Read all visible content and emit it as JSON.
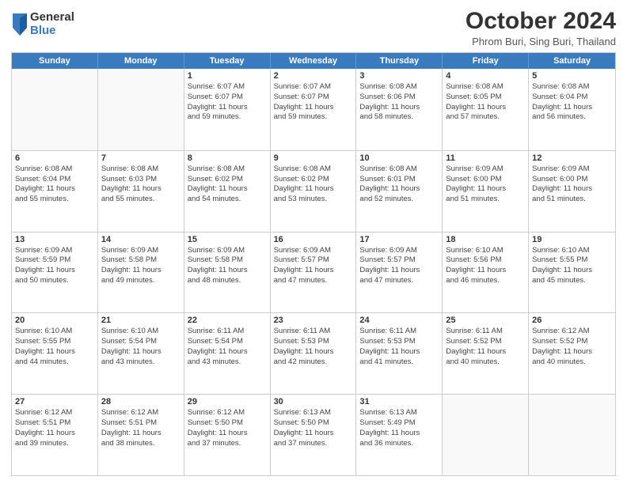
{
  "logo": {
    "general": "General",
    "blue": "Blue"
  },
  "header": {
    "title": "October 2024",
    "subtitle": "Phrom Buri, Sing Buri, Thailand"
  },
  "weekdays": [
    "Sunday",
    "Monday",
    "Tuesday",
    "Wednesday",
    "Thursday",
    "Friday",
    "Saturday"
  ],
  "weeks": [
    [
      {
        "day": "",
        "lines": []
      },
      {
        "day": "",
        "lines": []
      },
      {
        "day": "1",
        "lines": [
          "Sunrise: 6:07 AM",
          "Sunset: 6:07 PM",
          "Daylight: 11 hours",
          "and 59 minutes."
        ]
      },
      {
        "day": "2",
        "lines": [
          "Sunrise: 6:07 AM",
          "Sunset: 6:07 PM",
          "Daylight: 11 hours",
          "and 59 minutes."
        ]
      },
      {
        "day": "3",
        "lines": [
          "Sunrise: 6:08 AM",
          "Sunset: 6:06 PM",
          "Daylight: 11 hours",
          "and 58 minutes."
        ]
      },
      {
        "day": "4",
        "lines": [
          "Sunrise: 6:08 AM",
          "Sunset: 6:05 PM",
          "Daylight: 11 hours",
          "and 57 minutes."
        ]
      },
      {
        "day": "5",
        "lines": [
          "Sunrise: 6:08 AM",
          "Sunset: 6:04 PM",
          "Daylight: 11 hours",
          "and 56 minutes."
        ]
      }
    ],
    [
      {
        "day": "6",
        "lines": [
          "Sunrise: 6:08 AM",
          "Sunset: 6:04 PM",
          "Daylight: 11 hours",
          "and 55 minutes."
        ]
      },
      {
        "day": "7",
        "lines": [
          "Sunrise: 6:08 AM",
          "Sunset: 6:03 PM",
          "Daylight: 11 hours",
          "and 55 minutes."
        ]
      },
      {
        "day": "8",
        "lines": [
          "Sunrise: 6:08 AM",
          "Sunset: 6:02 PM",
          "Daylight: 11 hours",
          "and 54 minutes."
        ]
      },
      {
        "day": "9",
        "lines": [
          "Sunrise: 6:08 AM",
          "Sunset: 6:02 PM",
          "Daylight: 11 hours",
          "and 53 minutes."
        ]
      },
      {
        "day": "10",
        "lines": [
          "Sunrise: 6:08 AM",
          "Sunset: 6:01 PM",
          "Daylight: 11 hours",
          "and 52 minutes."
        ]
      },
      {
        "day": "11",
        "lines": [
          "Sunrise: 6:09 AM",
          "Sunset: 6:00 PM",
          "Daylight: 11 hours",
          "and 51 minutes."
        ]
      },
      {
        "day": "12",
        "lines": [
          "Sunrise: 6:09 AM",
          "Sunset: 6:00 PM",
          "Daylight: 11 hours",
          "and 51 minutes."
        ]
      }
    ],
    [
      {
        "day": "13",
        "lines": [
          "Sunrise: 6:09 AM",
          "Sunset: 5:59 PM",
          "Daylight: 11 hours",
          "and 50 minutes."
        ]
      },
      {
        "day": "14",
        "lines": [
          "Sunrise: 6:09 AM",
          "Sunset: 5:58 PM",
          "Daylight: 11 hours",
          "and 49 minutes."
        ]
      },
      {
        "day": "15",
        "lines": [
          "Sunrise: 6:09 AM",
          "Sunset: 5:58 PM",
          "Daylight: 11 hours",
          "and 48 minutes."
        ]
      },
      {
        "day": "16",
        "lines": [
          "Sunrise: 6:09 AM",
          "Sunset: 5:57 PM",
          "Daylight: 11 hours",
          "and 47 minutes."
        ]
      },
      {
        "day": "17",
        "lines": [
          "Sunrise: 6:09 AM",
          "Sunset: 5:57 PM",
          "Daylight: 11 hours",
          "and 47 minutes."
        ]
      },
      {
        "day": "18",
        "lines": [
          "Sunrise: 6:10 AM",
          "Sunset: 5:56 PM",
          "Daylight: 11 hours",
          "and 46 minutes."
        ]
      },
      {
        "day": "19",
        "lines": [
          "Sunrise: 6:10 AM",
          "Sunset: 5:55 PM",
          "Daylight: 11 hours",
          "and 45 minutes."
        ]
      }
    ],
    [
      {
        "day": "20",
        "lines": [
          "Sunrise: 6:10 AM",
          "Sunset: 5:55 PM",
          "Daylight: 11 hours",
          "and 44 minutes."
        ]
      },
      {
        "day": "21",
        "lines": [
          "Sunrise: 6:10 AM",
          "Sunset: 5:54 PM",
          "Daylight: 11 hours",
          "and 43 minutes."
        ]
      },
      {
        "day": "22",
        "lines": [
          "Sunrise: 6:11 AM",
          "Sunset: 5:54 PM",
          "Daylight: 11 hours",
          "and 43 minutes."
        ]
      },
      {
        "day": "23",
        "lines": [
          "Sunrise: 6:11 AM",
          "Sunset: 5:53 PM",
          "Daylight: 11 hours",
          "and 42 minutes."
        ]
      },
      {
        "day": "24",
        "lines": [
          "Sunrise: 6:11 AM",
          "Sunset: 5:53 PM",
          "Daylight: 11 hours",
          "and 41 minutes."
        ]
      },
      {
        "day": "25",
        "lines": [
          "Sunrise: 6:11 AM",
          "Sunset: 5:52 PM",
          "Daylight: 11 hours",
          "and 40 minutes."
        ]
      },
      {
        "day": "26",
        "lines": [
          "Sunrise: 6:12 AM",
          "Sunset: 5:52 PM",
          "Daylight: 11 hours",
          "and 40 minutes."
        ]
      }
    ],
    [
      {
        "day": "27",
        "lines": [
          "Sunrise: 6:12 AM",
          "Sunset: 5:51 PM",
          "Daylight: 11 hours",
          "and 39 minutes."
        ]
      },
      {
        "day": "28",
        "lines": [
          "Sunrise: 6:12 AM",
          "Sunset: 5:51 PM",
          "Daylight: 11 hours",
          "and 38 minutes."
        ]
      },
      {
        "day": "29",
        "lines": [
          "Sunrise: 6:12 AM",
          "Sunset: 5:50 PM",
          "Daylight: 11 hours",
          "and 37 minutes."
        ]
      },
      {
        "day": "30",
        "lines": [
          "Sunrise: 6:13 AM",
          "Sunset: 5:50 PM",
          "Daylight: 11 hours",
          "and 37 minutes."
        ]
      },
      {
        "day": "31",
        "lines": [
          "Sunrise: 6:13 AM",
          "Sunset: 5:49 PM",
          "Daylight: 11 hours",
          "and 36 minutes."
        ]
      },
      {
        "day": "",
        "lines": []
      },
      {
        "day": "",
        "lines": []
      }
    ]
  ]
}
